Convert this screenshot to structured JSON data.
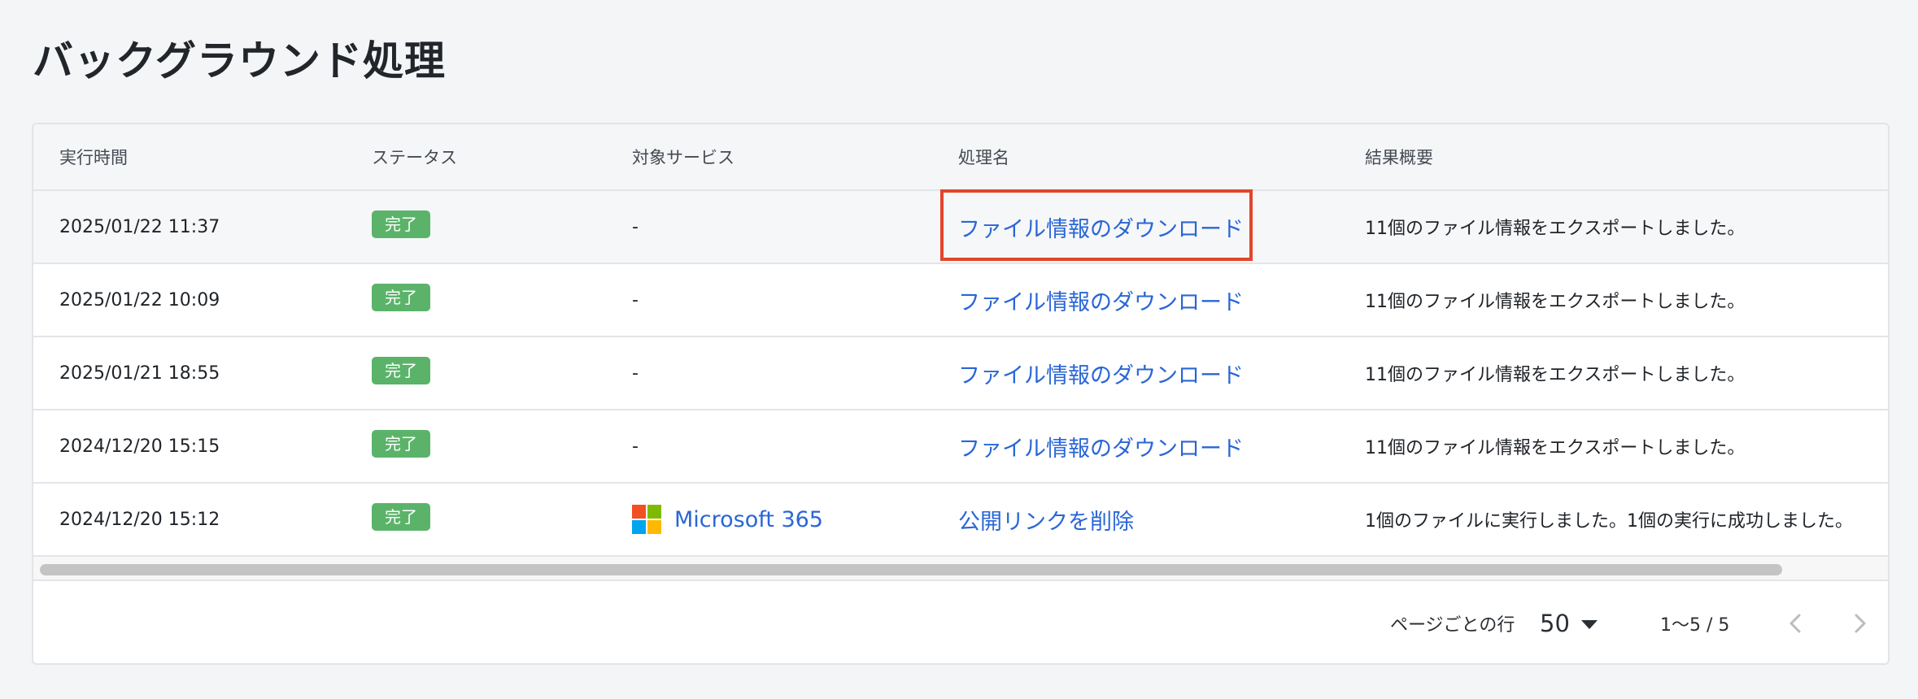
{
  "page": {
    "title": "バックグラウンド処理"
  },
  "table": {
    "columns": [
      "実行時間",
      "ステータス",
      "対象サービス",
      "処理名",
      "結果概要"
    ],
    "rows": [
      {
        "time": "2025/01/22 11:37",
        "status": "完了",
        "service": "-",
        "service_icon": "",
        "process": "ファイル情報のダウンロード",
        "summary": "11個のファイル情報をエクスポートしました。",
        "highlighted": true
      },
      {
        "time": "2025/01/22 10:09",
        "status": "完了",
        "service": "-",
        "service_icon": "",
        "process": "ファイル情報のダウンロード",
        "summary": "11個のファイル情報をエクスポートしました。",
        "highlighted": false
      },
      {
        "time": "2025/01/21 18:55",
        "status": "完了",
        "service": "-",
        "service_icon": "",
        "process": "ファイル情報のダウンロード",
        "summary": "11個のファイル情報をエクスポートしました。",
        "highlighted": false
      },
      {
        "time": "2024/12/20 15:15",
        "status": "完了",
        "service": "-",
        "service_icon": "",
        "process": "ファイル情報のダウンロード",
        "summary": "11個のファイル情報をエクスポートしました。",
        "highlighted": false
      },
      {
        "time": "2024/12/20 15:12",
        "status": "完了",
        "service": "Microsoft 365",
        "service_icon": "microsoft-logo-icon",
        "process": "公開リンクを削除",
        "summary": "1個のファイルに実行しました。1個の実行に成功しました。",
        "highlighted": false
      }
    ]
  },
  "footer": {
    "rows_per_page_label": "ページごとの行",
    "rows_per_page_value": "50",
    "range_text": "1〜5 / 5",
    "prev_icon": "chevron-left-icon",
    "next_icon": "chevron-right-icon"
  },
  "colors": {
    "background": "#f4f5f7",
    "status_complete": "#5bb36a",
    "link": "#2a66d6",
    "highlight_border": "#e2452b"
  }
}
